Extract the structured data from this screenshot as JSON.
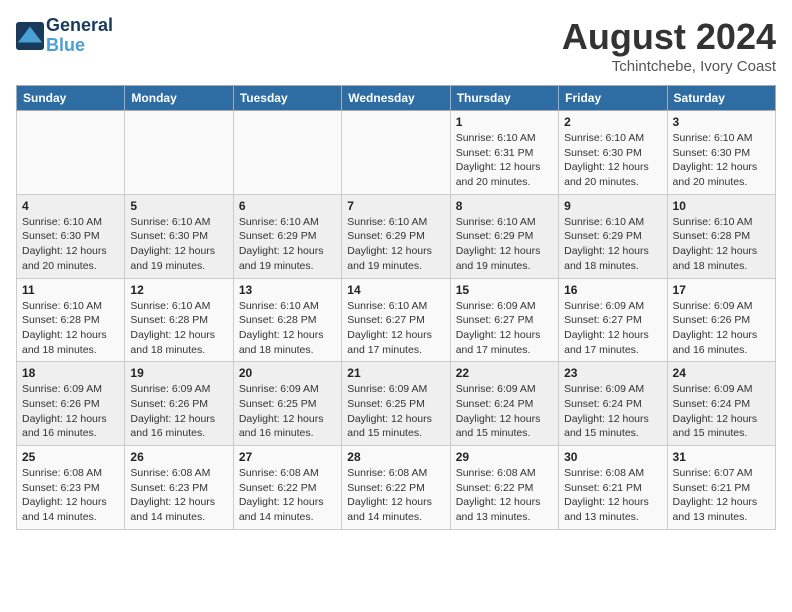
{
  "header": {
    "logo_line1": "General",
    "logo_line2": "Blue",
    "month": "August 2024",
    "location": "Tchintchebe, Ivory Coast"
  },
  "days_of_week": [
    "Sunday",
    "Monday",
    "Tuesday",
    "Wednesday",
    "Thursday",
    "Friday",
    "Saturday"
  ],
  "weeks": [
    [
      {
        "day": "",
        "info": ""
      },
      {
        "day": "",
        "info": ""
      },
      {
        "day": "",
        "info": ""
      },
      {
        "day": "",
        "info": ""
      },
      {
        "day": "1",
        "info": "Sunrise: 6:10 AM\nSunset: 6:31 PM\nDaylight: 12 hours\nand 20 minutes."
      },
      {
        "day": "2",
        "info": "Sunrise: 6:10 AM\nSunset: 6:30 PM\nDaylight: 12 hours\nand 20 minutes."
      },
      {
        "day": "3",
        "info": "Sunrise: 6:10 AM\nSunset: 6:30 PM\nDaylight: 12 hours\nand 20 minutes."
      }
    ],
    [
      {
        "day": "4",
        "info": "Sunrise: 6:10 AM\nSunset: 6:30 PM\nDaylight: 12 hours\nand 20 minutes."
      },
      {
        "day": "5",
        "info": "Sunrise: 6:10 AM\nSunset: 6:30 PM\nDaylight: 12 hours\nand 19 minutes."
      },
      {
        "day": "6",
        "info": "Sunrise: 6:10 AM\nSunset: 6:29 PM\nDaylight: 12 hours\nand 19 minutes."
      },
      {
        "day": "7",
        "info": "Sunrise: 6:10 AM\nSunset: 6:29 PM\nDaylight: 12 hours\nand 19 minutes."
      },
      {
        "day": "8",
        "info": "Sunrise: 6:10 AM\nSunset: 6:29 PM\nDaylight: 12 hours\nand 19 minutes."
      },
      {
        "day": "9",
        "info": "Sunrise: 6:10 AM\nSunset: 6:29 PM\nDaylight: 12 hours\nand 18 minutes."
      },
      {
        "day": "10",
        "info": "Sunrise: 6:10 AM\nSunset: 6:28 PM\nDaylight: 12 hours\nand 18 minutes."
      }
    ],
    [
      {
        "day": "11",
        "info": "Sunrise: 6:10 AM\nSunset: 6:28 PM\nDaylight: 12 hours\nand 18 minutes."
      },
      {
        "day": "12",
        "info": "Sunrise: 6:10 AM\nSunset: 6:28 PM\nDaylight: 12 hours\nand 18 minutes."
      },
      {
        "day": "13",
        "info": "Sunrise: 6:10 AM\nSunset: 6:28 PM\nDaylight: 12 hours\nand 18 minutes."
      },
      {
        "day": "14",
        "info": "Sunrise: 6:10 AM\nSunset: 6:27 PM\nDaylight: 12 hours\nand 17 minutes."
      },
      {
        "day": "15",
        "info": "Sunrise: 6:09 AM\nSunset: 6:27 PM\nDaylight: 12 hours\nand 17 minutes."
      },
      {
        "day": "16",
        "info": "Sunrise: 6:09 AM\nSunset: 6:27 PM\nDaylight: 12 hours\nand 17 minutes."
      },
      {
        "day": "17",
        "info": "Sunrise: 6:09 AM\nSunset: 6:26 PM\nDaylight: 12 hours\nand 16 minutes."
      }
    ],
    [
      {
        "day": "18",
        "info": "Sunrise: 6:09 AM\nSunset: 6:26 PM\nDaylight: 12 hours\nand 16 minutes."
      },
      {
        "day": "19",
        "info": "Sunrise: 6:09 AM\nSunset: 6:26 PM\nDaylight: 12 hours\nand 16 minutes."
      },
      {
        "day": "20",
        "info": "Sunrise: 6:09 AM\nSunset: 6:25 PM\nDaylight: 12 hours\nand 16 minutes."
      },
      {
        "day": "21",
        "info": "Sunrise: 6:09 AM\nSunset: 6:25 PM\nDaylight: 12 hours\nand 15 minutes."
      },
      {
        "day": "22",
        "info": "Sunrise: 6:09 AM\nSunset: 6:24 PM\nDaylight: 12 hours\nand 15 minutes."
      },
      {
        "day": "23",
        "info": "Sunrise: 6:09 AM\nSunset: 6:24 PM\nDaylight: 12 hours\nand 15 minutes."
      },
      {
        "day": "24",
        "info": "Sunrise: 6:09 AM\nSunset: 6:24 PM\nDaylight: 12 hours\nand 15 minutes."
      }
    ],
    [
      {
        "day": "25",
        "info": "Sunrise: 6:08 AM\nSunset: 6:23 PM\nDaylight: 12 hours\nand 14 minutes."
      },
      {
        "day": "26",
        "info": "Sunrise: 6:08 AM\nSunset: 6:23 PM\nDaylight: 12 hours\nand 14 minutes."
      },
      {
        "day": "27",
        "info": "Sunrise: 6:08 AM\nSunset: 6:22 PM\nDaylight: 12 hours\nand 14 minutes."
      },
      {
        "day": "28",
        "info": "Sunrise: 6:08 AM\nSunset: 6:22 PM\nDaylight: 12 hours\nand 14 minutes."
      },
      {
        "day": "29",
        "info": "Sunrise: 6:08 AM\nSunset: 6:22 PM\nDaylight: 12 hours\nand 13 minutes."
      },
      {
        "day": "30",
        "info": "Sunrise: 6:08 AM\nSunset: 6:21 PM\nDaylight: 12 hours\nand 13 minutes."
      },
      {
        "day": "31",
        "info": "Sunrise: 6:07 AM\nSunset: 6:21 PM\nDaylight: 12 hours\nand 13 minutes."
      }
    ]
  ]
}
